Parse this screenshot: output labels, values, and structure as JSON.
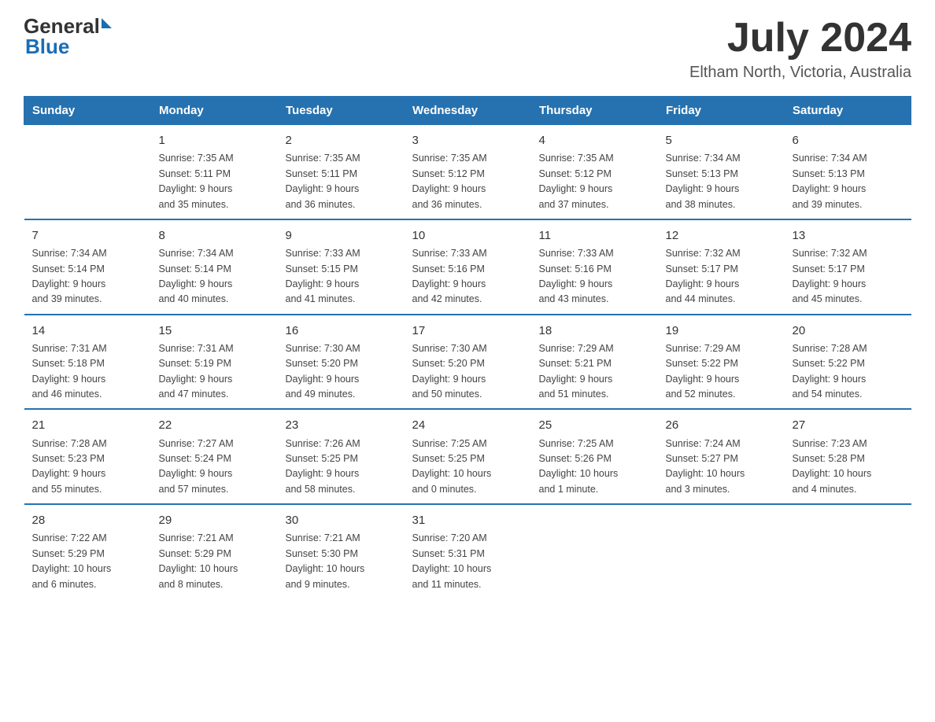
{
  "header": {
    "logo_text_general": "General",
    "logo_text_blue": "Blue",
    "month_title": "July 2024",
    "location": "Eltham North, Victoria, Australia"
  },
  "days_of_week": [
    "Sunday",
    "Monday",
    "Tuesday",
    "Wednesday",
    "Thursday",
    "Friday",
    "Saturday"
  ],
  "weeks": [
    [
      {
        "day": "",
        "info": ""
      },
      {
        "day": "1",
        "info": "Sunrise: 7:35 AM\nSunset: 5:11 PM\nDaylight: 9 hours\nand 35 minutes."
      },
      {
        "day": "2",
        "info": "Sunrise: 7:35 AM\nSunset: 5:11 PM\nDaylight: 9 hours\nand 36 minutes."
      },
      {
        "day": "3",
        "info": "Sunrise: 7:35 AM\nSunset: 5:12 PM\nDaylight: 9 hours\nand 36 minutes."
      },
      {
        "day": "4",
        "info": "Sunrise: 7:35 AM\nSunset: 5:12 PM\nDaylight: 9 hours\nand 37 minutes."
      },
      {
        "day": "5",
        "info": "Sunrise: 7:34 AM\nSunset: 5:13 PM\nDaylight: 9 hours\nand 38 minutes."
      },
      {
        "day": "6",
        "info": "Sunrise: 7:34 AM\nSunset: 5:13 PM\nDaylight: 9 hours\nand 39 minutes."
      }
    ],
    [
      {
        "day": "7",
        "info": "Sunrise: 7:34 AM\nSunset: 5:14 PM\nDaylight: 9 hours\nand 39 minutes."
      },
      {
        "day": "8",
        "info": "Sunrise: 7:34 AM\nSunset: 5:14 PM\nDaylight: 9 hours\nand 40 minutes."
      },
      {
        "day": "9",
        "info": "Sunrise: 7:33 AM\nSunset: 5:15 PM\nDaylight: 9 hours\nand 41 minutes."
      },
      {
        "day": "10",
        "info": "Sunrise: 7:33 AM\nSunset: 5:16 PM\nDaylight: 9 hours\nand 42 minutes."
      },
      {
        "day": "11",
        "info": "Sunrise: 7:33 AM\nSunset: 5:16 PM\nDaylight: 9 hours\nand 43 minutes."
      },
      {
        "day": "12",
        "info": "Sunrise: 7:32 AM\nSunset: 5:17 PM\nDaylight: 9 hours\nand 44 minutes."
      },
      {
        "day": "13",
        "info": "Sunrise: 7:32 AM\nSunset: 5:17 PM\nDaylight: 9 hours\nand 45 minutes."
      }
    ],
    [
      {
        "day": "14",
        "info": "Sunrise: 7:31 AM\nSunset: 5:18 PM\nDaylight: 9 hours\nand 46 minutes."
      },
      {
        "day": "15",
        "info": "Sunrise: 7:31 AM\nSunset: 5:19 PM\nDaylight: 9 hours\nand 47 minutes."
      },
      {
        "day": "16",
        "info": "Sunrise: 7:30 AM\nSunset: 5:20 PM\nDaylight: 9 hours\nand 49 minutes."
      },
      {
        "day": "17",
        "info": "Sunrise: 7:30 AM\nSunset: 5:20 PM\nDaylight: 9 hours\nand 50 minutes."
      },
      {
        "day": "18",
        "info": "Sunrise: 7:29 AM\nSunset: 5:21 PM\nDaylight: 9 hours\nand 51 minutes."
      },
      {
        "day": "19",
        "info": "Sunrise: 7:29 AM\nSunset: 5:22 PM\nDaylight: 9 hours\nand 52 minutes."
      },
      {
        "day": "20",
        "info": "Sunrise: 7:28 AM\nSunset: 5:22 PM\nDaylight: 9 hours\nand 54 minutes."
      }
    ],
    [
      {
        "day": "21",
        "info": "Sunrise: 7:28 AM\nSunset: 5:23 PM\nDaylight: 9 hours\nand 55 minutes."
      },
      {
        "day": "22",
        "info": "Sunrise: 7:27 AM\nSunset: 5:24 PM\nDaylight: 9 hours\nand 57 minutes."
      },
      {
        "day": "23",
        "info": "Sunrise: 7:26 AM\nSunset: 5:25 PM\nDaylight: 9 hours\nand 58 minutes."
      },
      {
        "day": "24",
        "info": "Sunrise: 7:25 AM\nSunset: 5:25 PM\nDaylight: 10 hours\nand 0 minutes."
      },
      {
        "day": "25",
        "info": "Sunrise: 7:25 AM\nSunset: 5:26 PM\nDaylight: 10 hours\nand 1 minute."
      },
      {
        "day": "26",
        "info": "Sunrise: 7:24 AM\nSunset: 5:27 PM\nDaylight: 10 hours\nand 3 minutes."
      },
      {
        "day": "27",
        "info": "Sunrise: 7:23 AM\nSunset: 5:28 PM\nDaylight: 10 hours\nand 4 minutes."
      }
    ],
    [
      {
        "day": "28",
        "info": "Sunrise: 7:22 AM\nSunset: 5:29 PM\nDaylight: 10 hours\nand 6 minutes."
      },
      {
        "day": "29",
        "info": "Sunrise: 7:21 AM\nSunset: 5:29 PM\nDaylight: 10 hours\nand 8 minutes."
      },
      {
        "day": "30",
        "info": "Sunrise: 7:21 AM\nSunset: 5:30 PM\nDaylight: 10 hours\nand 9 minutes."
      },
      {
        "day": "31",
        "info": "Sunrise: 7:20 AM\nSunset: 5:31 PM\nDaylight: 10 hours\nand 11 minutes."
      },
      {
        "day": "",
        "info": ""
      },
      {
        "day": "",
        "info": ""
      },
      {
        "day": "",
        "info": ""
      }
    ]
  ]
}
